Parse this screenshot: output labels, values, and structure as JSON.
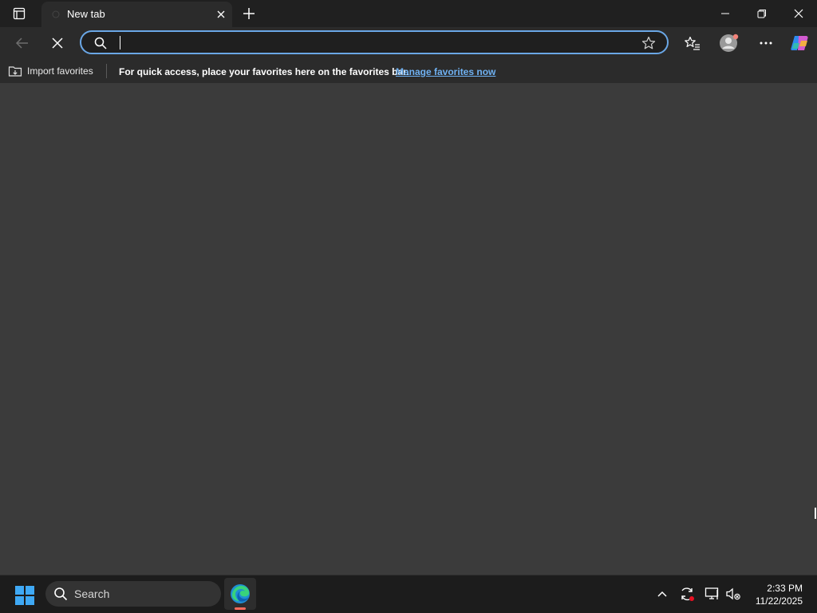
{
  "browser": {
    "tab": {
      "title": "New tab"
    },
    "address_bar": {
      "value": "",
      "placeholder": ""
    },
    "favorites_bar": {
      "import_label": "Import favorites",
      "message": "For quick access, place your favorites here on the favorites bar.",
      "manage_link": "Manage favorites now"
    }
  },
  "taskbar": {
    "search_label": "Search",
    "time": "2:33 PM",
    "date": "11/22/2025"
  },
  "colors": {
    "accent": "#6aa7e6",
    "link": "#6fb1f2",
    "page_background": "#3b3b3b",
    "chrome_dark": "#202020",
    "toolbar": "#2b2b2b"
  },
  "icons": [
    "tab-actions-icon",
    "tab-close-icon",
    "new-tab-icon",
    "minimize-icon",
    "restore-icon",
    "close-window-icon",
    "back-icon",
    "stop-icon",
    "search-icon",
    "favorite-star-icon",
    "favorites-icon",
    "profile-icon",
    "more-icon",
    "copilot-icon",
    "import-favorites-icon",
    "windows-start-icon",
    "edge-icon",
    "chevron-up-icon",
    "sync-icon",
    "display-icon",
    "speaker-muted-icon"
  ]
}
